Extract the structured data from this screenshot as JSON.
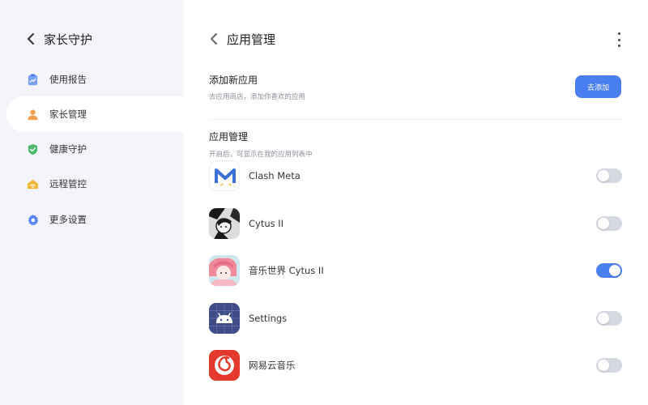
{
  "sidebar": {
    "title": "家长守护",
    "items": [
      {
        "label": "使用报告",
        "icon": "report-icon",
        "active": false
      },
      {
        "label": "家长管理",
        "icon": "user-icon",
        "active": true
      },
      {
        "label": "健康守护",
        "icon": "shield-check-icon",
        "active": false
      },
      {
        "label": "远程管控",
        "icon": "remote-icon",
        "active": false
      },
      {
        "label": "更多设置",
        "icon": "gear-icon",
        "active": false
      }
    ]
  },
  "main": {
    "title": "应用管理",
    "add_section": {
      "title": "添加新应用",
      "subtitle": "去应用商店，添加你喜欢的应用",
      "button_label": "去添加"
    },
    "apps_section": {
      "title": "应用管理",
      "subtitle": "开启后，可显示在我的应用列表中"
    },
    "apps": [
      {
        "name": "Clash Meta",
        "icon": "clash-meta-icon",
        "enabled": false
      },
      {
        "name": "Cytus II",
        "icon": "cytus-icon",
        "enabled": false
      },
      {
        "name": "音乐世界 Cytus II",
        "icon": "cytus-cn-icon",
        "enabled": true
      },
      {
        "name": "Settings",
        "icon": "android-settings-icon",
        "enabled": false
      },
      {
        "name": "网易云音乐",
        "icon": "netease-music-icon",
        "enabled": false
      }
    ]
  },
  "colors": {
    "accent": "#4a7ff0",
    "sidebar_bg": "#f3f5fa",
    "toggle_off": "#d5d9e2"
  }
}
